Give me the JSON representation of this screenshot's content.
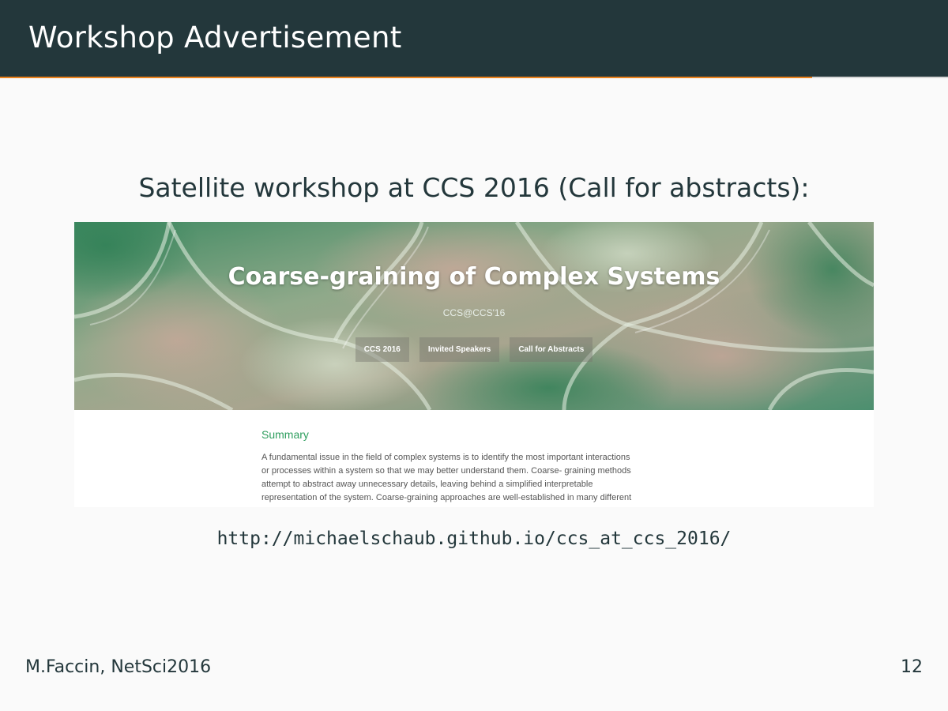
{
  "slide": {
    "title": "Workshop Advertisement",
    "subtitle": "Satellite workshop at CCS 2016 (Call for abstracts):",
    "url": "http://michaelschaub.github.io/ccs_at_ccs_2016/",
    "footer_left": "M.Faccin, NetSci2016",
    "page_number": "12",
    "progress": 0.857,
    "colors": {
      "title_bar": "#23373b",
      "accent": "#eb811b",
      "background": "#fafafa",
      "summary_heading": "#2e9e5e"
    }
  },
  "website": {
    "hero_title": "Coarse-graining of Complex Systems",
    "hero_subtitle": "CCS@CCS'16",
    "nav": [
      {
        "label": "CCS 2016"
      },
      {
        "label": "Invited Speakers"
      },
      {
        "label": "Call for Abstracts"
      }
    ],
    "summary_heading": "Summary",
    "summary_lines": [
      "A fundamental issue in the field of complex systems is to identify the most important interactions",
      "or processes within a system so that we may better understand them. Coarse- graining methods",
      "attempt to abstract away unnecessary details, leaving behind a simplified interpretable",
      "representation of the system. Coarse-graining approaches are well-established in many different"
    ]
  }
}
